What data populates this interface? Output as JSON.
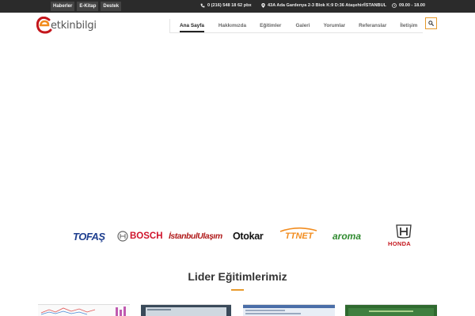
{
  "topbar": {
    "links": [
      "Haberler",
      "E-Kitap",
      "Destek"
    ],
    "phone": "0 (216) 548 18 62 pbx",
    "address": "43A Ada Gardenya 2-3 Blok K:9 D:36 Ataşehir/İSTANBUL",
    "hours": "09.00 - 18.00"
  },
  "header": {
    "logo_text": "etkinbilgi",
    "nav": [
      "Ana Sayfa",
      "Hakkımızda",
      "Eğitimler",
      "Galeri",
      "Yorumlar",
      "Referanslar",
      "İletişim"
    ],
    "active_nav": "Ana Sayfa"
  },
  "brands": {
    "items": [
      "TOFAŞ",
      "BOSCH",
      "İstanbulUlaşım",
      "Otokar",
      "TTNET",
      "aroma",
      "HONDA"
    ]
  },
  "section": {
    "title": "Lider Eğitimlerimiz"
  },
  "colors": {
    "accent": "#e89a2c",
    "topbar": "#2b2b2b",
    "logo_red": "#c4161c",
    "logo_orange": "#f28c1e"
  }
}
